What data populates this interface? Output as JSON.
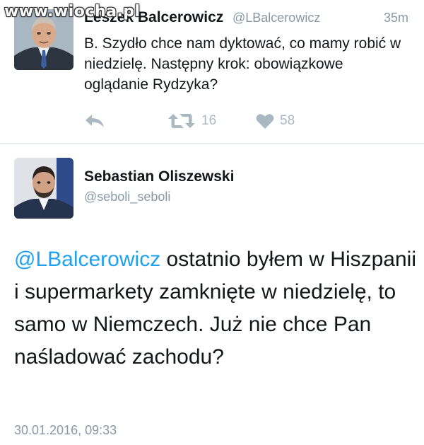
{
  "watermark": "www.wiocha.pl",
  "tweet1": {
    "author_name": "Leszek Balcerowicz",
    "handle": "@LBalcerowicz",
    "time": "35m",
    "text": "B. Szydło chce nam dyktować, co mamy robić w niedzielę. Następny krok: obowiązkowe oglądanie Rydzyka?",
    "retweets": "16",
    "likes": "58",
    "icons": {
      "reply": "reply-icon",
      "retweet": "retweet-icon",
      "like": "heart-icon"
    }
  },
  "tweet2": {
    "author_name": "Sebastian Oliszewski",
    "handle": "@seboli_seboli",
    "mention": "@LBalcerowicz",
    "text": " ostatnio byłem w Hiszpanii i supermarkety zamknięte w niedzielę, to samo w Niemczech. Już nie chce Pan naśladować zachodu?",
    "date": "30.01.2016, 09:33"
  },
  "colors": {
    "text": "#14171a",
    "muted": "#8899a6",
    "icon": "#aab8c2",
    "link": "#1da1f2",
    "divider": "#e1e8ed"
  }
}
